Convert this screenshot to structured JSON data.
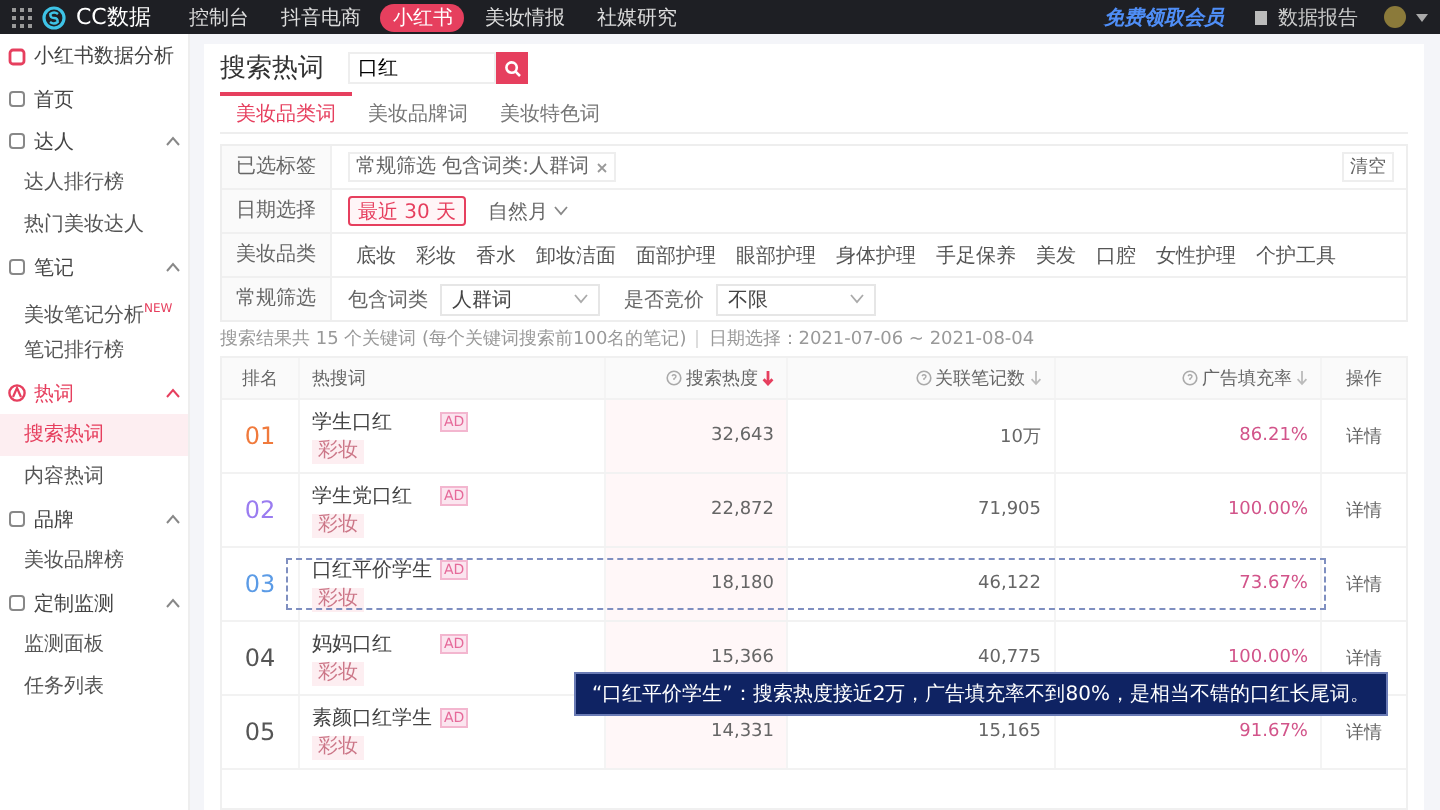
{
  "top_bar": {
    "logo": "CC数据",
    "nav": [
      {
        "label": "控制台",
        "selected": false
      },
      {
        "label": "抖音电商",
        "selected": false
      },
      {
        "label": "小红书",
        "selected": true
      },
      {
        "label": "美妆情报",
        "selected": false
      },
      {
        "label": "社媒研究",
        "selected": false
      }
    ],
    "promo": "免费领取会员",
    "report": "数据报告"
  },
  "sidebar": {
    "title": "小红书数据分析",
    "items": [
      {
        "label": "首页"
      },
      {
        "label": "达人",
        "expanded": true,
        "children": [
          {
            "label": "达人排行榜",
            "selected": false
          },
          {
            "label": "热门美妆达人",
            "selected": false
          }
        ]
      },
      {
        "label": "笔记",
        "expanded": true,
        "children": [
          {
            "label": "美妆笔记分析",
            "badge": "NEW",
            "selected": false
          },
          {
            "label": "笔记排行榜",
            "selected": false
          }
        ]
      },
      {
        "label": "热词",
        "expanded": true,
        "children": [
          {
            "label": "搜索热词",
            "selected": true
          },
          {
            "label": "内容热词",
            "selected": false
          }
        ]
      },
      {
        "label": "品牌",
        "expanded": true,
        "children": [
          {
            "label": "美妆品牌榜",
            "selected": false
          }
        ]
      },
      {
        "label": "定制监测",
        "expanded": true,
        "children": [
          {
            "label": "监测面板",
            "selected": false
          },
          {
            "label": "任务列表",
            "selected": false
          }
        ]
      }
    ]
  },
  "page_title": "搜索热词",
  "search": {
    "value": "口红"
  },
  "tabs": [
    {
      "label": "美妆品类词",
      "selected": true
    },
    {
      "label": "美妆品牌词",
      "selected": false
    },
    {
      "label": "美妆特色词",
      "selected": false
    }
  ],
  "filters": {
    "selected_tags": {
      "label": "已选标签",
      "tags": [
        "常规筛选 包含词类:人群词"
      ],
      "clear": "清空"
    },
    "date": {
      "label": "日期选择",
      "options": [
        {
          "label": "最近 30 天",
          "selected": true,
          "kind": "button"
        },
        {
          "label": "自然月",
          "selected": false,
          "kind": "dropdown"
        }
      ]
    },
    "category": {
      "label": "美妆品类",
      "options": [
        "底妆",
        "彩妆",
        "香水",
        "卸妆洁面",
        "面部护理",
        "眼部护理",
        "身体护理",
        "手足保养",
        "美发",
        "口腔",
        "女性护理",
        "个护工具"
      ]
    },
    "general": {
      "label": "常规筛选",
      "selects": [
        {
          "label": "包含词类",
          "value": "人群词"
        },
        {
          "label": "是否竞价",
          "value": "不限"
        }
      ]
    }
  },
  "summary": {
    "result": "搜索结果共 15 个关键词 (每个关键词搜索前100名的笔记)",
    "date_range": "日期选择：2021-07-06 ~ 2021-08-04"
  },
  "table": {
    "columns": [
      {
        "label": "排名",
        "help": false,
        "sortable": false
      },
      {
        "label": "热搜词",
        "help": false,
        "sortable": false
      },
      {
        "label": "搜索热度",
        "help": true,
        "sortable": true,
        "sorted": true
      },
      {
        "label": "关联笔记数",
        "help": true,
        "sortable": true,
        "sorted": false
      },
      {
        "label": "广告填充率",
        "help": true,
        "sortable": true,
        "sorted": false
      },
      {
        "label": "操作",
        "help": false,
        "sortable": false
      }
    ],
    "rows": [
      {
        "rank": "01",
        "color": "#f07a3c",
        "word": "学生口红",
        "ad": "AD",
        "tag": "彩妆",
        "heat": "32,643",
        "notes": "10万",
        "fill": "86.21%",
        "action": "详情",
        "highlighted": false
      },
      {
        "rank": "02",
        "color": "#9a7cf0",
        "word": "学生党口红",
        "ad": "AD",
        "tag": "彩妆",
        "heat": "22,872",
        "notes": "71,905",
        "fill": "100.00%",
        "action": "详情",
        "highlighted": false
      },
      {
        "rank": "03",
        "color": "#5b9be6",
        "word": "口红平价学生",
        "ad": "AD",
        "tag": "彩妆",
        "heat": "18,180",
        "notes": "46,122",
        "fill": "73.67%",
        "action": "详情",
        "highlighted": true
      },
      {
        "rank": "04",
        "color": "#555555",
        "word": "妈妈口红",
        "ad": "AD",
        "tag": "彩妆",
        "heat": "15,366",
        "notes": "40,775",
        "fill": "100.00%",
        "action": "详情",
        "highlighted": false
      },
      {
        "rank": "05",
        "color": "#555555",
        "word": "素颜口红学生",
        "ad": "AD",
        "tag": "彩妆",
        "heat": "14,331",
        "notes": "15,165",
        "fill": "91.67%",
        "action": "详情",
        "highlighted": false
      }
    ]
  },
  "caption": "“口红平价学生”：搜索热度接近2万，广告填充率不到80%，是相当不错的口红长尾词。"
}
